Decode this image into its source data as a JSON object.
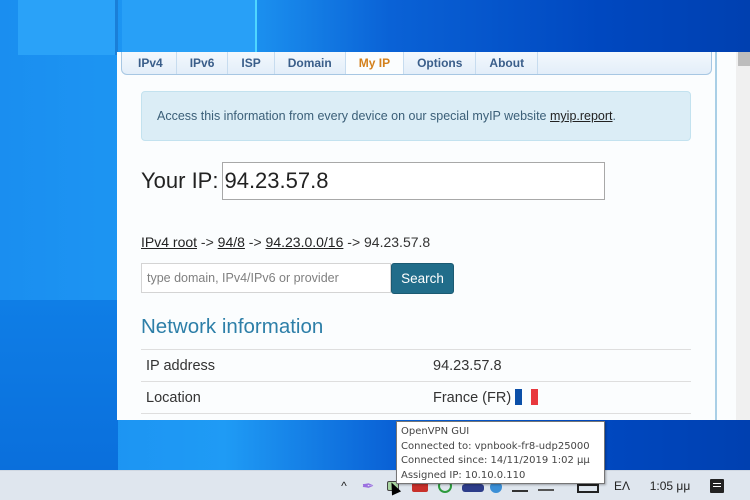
{
  "tabs": [
    {
      "label": "IPv4",
      "active": false
    },
    {
      "label": "IPv6",
      "active": false
    },
    {
      "label": "ISP",
      "active": false
    },
    {
      "label": "Domain",
      "active": false
    },
    {
      "label": "My IP",
      "active": true
    },
    {
      "label": "Options",
      "active": false
    },
    {
      "label": "About",
      "active": false
    }
  ],
  "notice": {
    "text": "Access this information from every device on our special myIP website ",
    "link": "myip.report",
    "suffix": "."
  },
  "your_ip": {
    "label": "Your IP:",
    "value": "94.23.57.8"
  },
  "breadcrumb": {
    "items": [
      {
        "label": "IPv4 root",
        "link": true
      },
      {
        "label": "94/8",
        "link": true
      },
      {
        "label": "94.23.0.0/16",
        "link": true
      },
      {
        "label": "94.23.57.8",
        "link": false
      }
    ],
    "separator": " -> "
  },
  "search": {
    "placeholder": "type domain, IPv4/IPv6 or provider",
    "value": "",
    "button_label": "Search"
  },
  "network": {
    "title": "Network information",
    "rows": [
      {
        "label": "IP address",
        "value": "94.23.57.8"
      },
      {
        "label": "Location",
        "value": "France (FR)",
        "flag": "france-flag"
      }
    ]
  },
  "tooltip": {
    "lines": [
      "OpenVPN GUI",
      "Connected to: vpnbook-fr8-udp25000",
      "Connected since: 14/11/2019 1:02 μμ",
      "Assigned IP: 10.10.0.110"
    ]
  },
  "taskbar": {
    "show_hidden_icon": "^",
    "language": "ΕΛ",
    "time": "1:05 μμ",
    "icons": [
      "chevron-up-icon",
      "feather-icon",
      "openvpn-icon",
      "action-center-icon"
    ]
  },
  "colors": {
    "active_tab": "#d3801c",
    "tab_text": "#3a5e8a",
    "search_button": "#216d8a",
    "section_title": "#2d7fa8",
    "notice_bg": "#dbedf6"
  }
}
